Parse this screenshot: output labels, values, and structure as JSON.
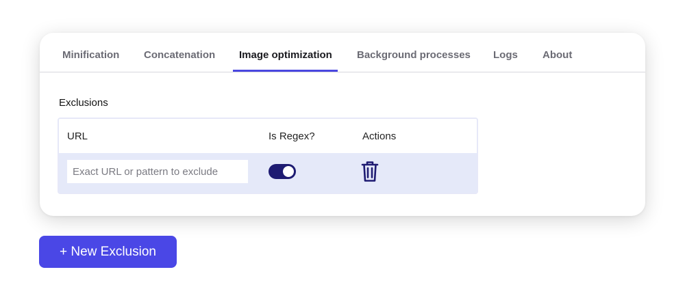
{
  "tabs": [
    {
      "label": "Minification"
    },
    {
      "label": "Concatenation"
    },
    {
      "label": "Image optimization",
      "active": true
    },
    {
      "label": "Background processes"
    },
    {
      "label": "Logs"
    },
    {
      "label": "About"
    }
  ],
  "exclusions": {
    "title": "Exclusions",
    "columns": [
      "URL",
      "Is Regex?",
      "Actions"
    ],
    "row": {
      "url_value": "",
      "url_placeholder": "Exact URL or pattern to exclude",
      "is_regex": true,
      "action_icon": "trash-icon"
    }
  },
  "new_exclusion_label": "+ New Exclusion",
  "colors": {
    "accent": "#4a47e0",
    "toggle_on": "#1e1b72",
    "row_bg": "#e5e9f9"
  }
}
